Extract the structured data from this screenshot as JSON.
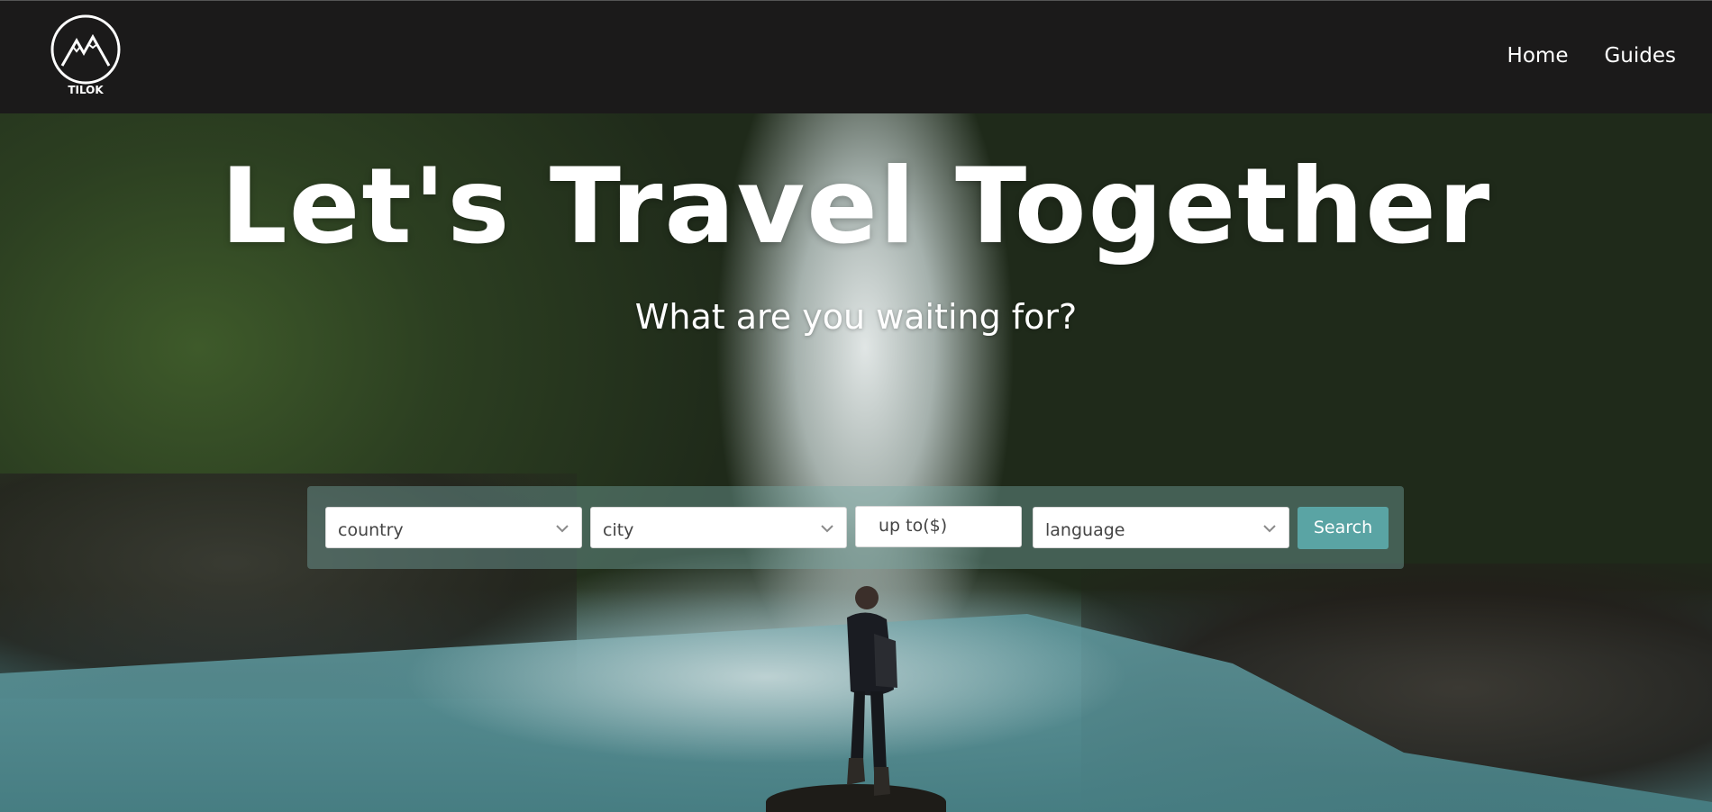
{
  "header": {
    "logo_text": "TILOK",
    "nav": [
      {
        "label": "Home"
      },
      {
        "label": "Guides"
      }
    ]
  },
  "hero": {
    "title": "Let's Travel Together",
    "subtitle": "What are you waiting for?"
  },
  "search": {
    "country_placeholder": "country",
    "city_placeholder": "city",
    "price_placeholder": "up to($)",
    "language_placeholder": "language",
    "button_label": "Search"
  },
  "colors": {
    "navbar_bg": "#1b1a1a",
    "search_button": "#5aa4a4",
    "text_primary": "#ffffff"
  },
  "icons": {
    "logo": "mountain-logo-icon",
    "dropdown": "chevron-down-icon"
  }
}
